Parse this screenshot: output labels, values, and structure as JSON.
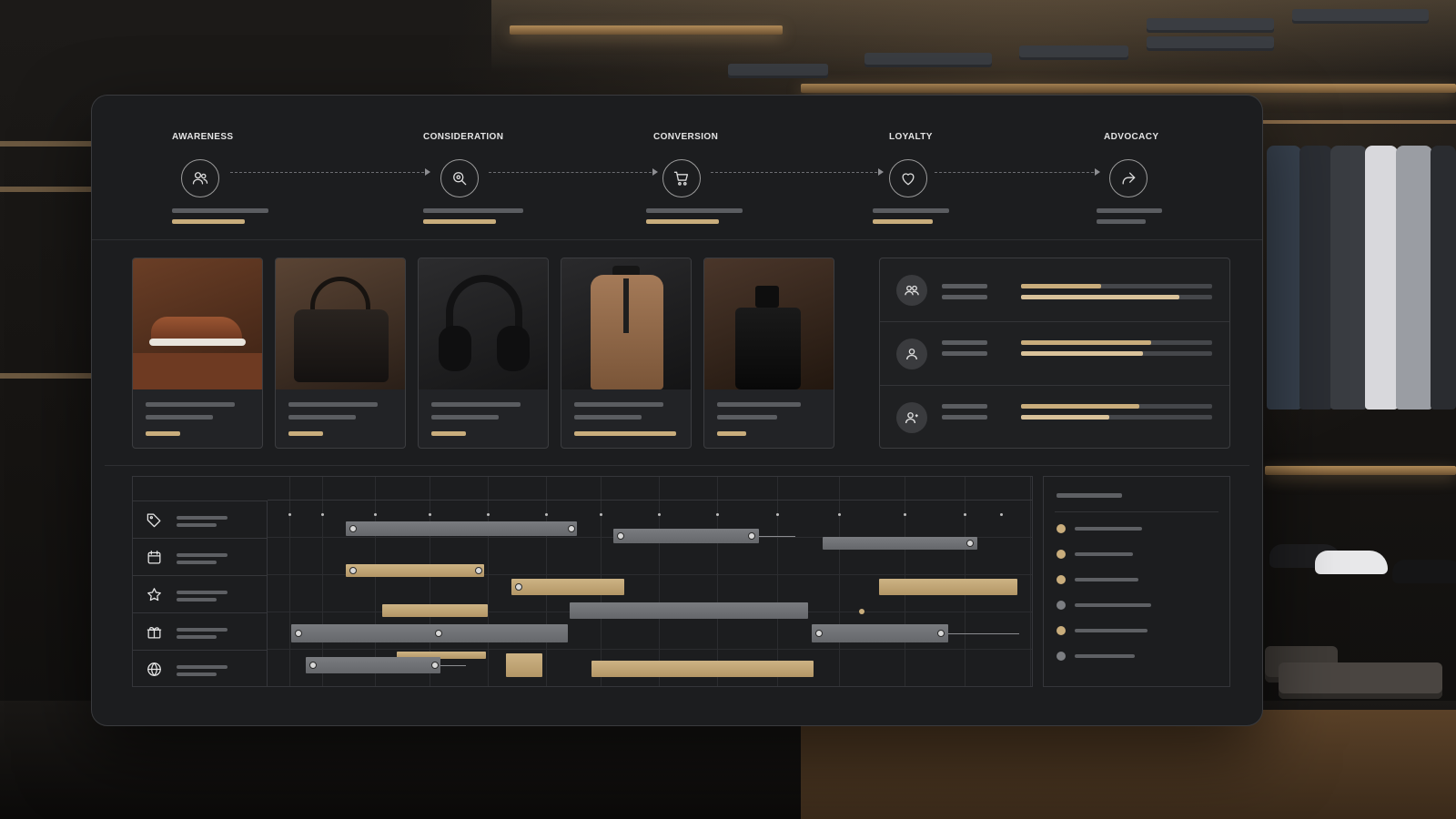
{
  "journey": {
    "stages": [
      {
        "label": "AWARENESS",
        "icon": "users-icon"
      },
      {
        "label": "CONSIDERATION",
        "icon": "search-icon"
      },
      {
        "label": "CONVERSION",
        "icon": "cart-icon"
      },
      {
        "label": "LOYALTY",
        "icon": "heart-icon"
      },
      {
        "label": "ADVOCACY",
        "icon": "share-icon"
      }
    ]
  },
  "products": [
    {
      "name": "sneaker",
      "icon": "sneaker-image"
    },
    {
      "name": "handbag",
      "icon": "handbag-image"
    },
    {
      "name": "headphones",
      "icon": "headphones-image"
    },
    {
      "name": "trench-coat",
      "icon": "coat-image"
    },
    {
      "name": "perfume",
      "icon": "perfume-image"
    }
  ],
  "segments": [
    {
      "icon": "group-icon",
      "metric_a": 0.42,
      "metric_b": 0.83
    },
    {
      "icon": "user-icon",
      "metric_a": 0.68,
      "metric_b": 0.64
    },
    {
      "icon": "user-plus-icon",
      "metric_a": 0.62,
      "metric_b": 0.46
    }
  ],
  "timeline": {
    "categories": [
      {
        "icon": "tag-icon"
      },
      {
        "icon": "calendar-icon"
      },
      {
        "icon": "star-icon"
      },
      {
        "icon": "gift-icon"
      },
      {
        "icon": "globe-icon"
      }
    ]
  },
  "legend": {
    "items": [
      {
        "color": "#c9ad7c"
      },
      {
        "color": "#c9ad7c"
      },
      {
        "color": "#c9ad7c"
      },
      {
        "color": "#7c7e82"
      },
      {
        "color": "#c9ad7c"
      },
      {
        "color": "#7c7e82"
      }
    ]
  },
  "colors": {
    "accent_gold": "#c9ad7c",
    "bar_grey": "#6e7074",
    "panel_bg": "#1c1d1f"
  }
}
